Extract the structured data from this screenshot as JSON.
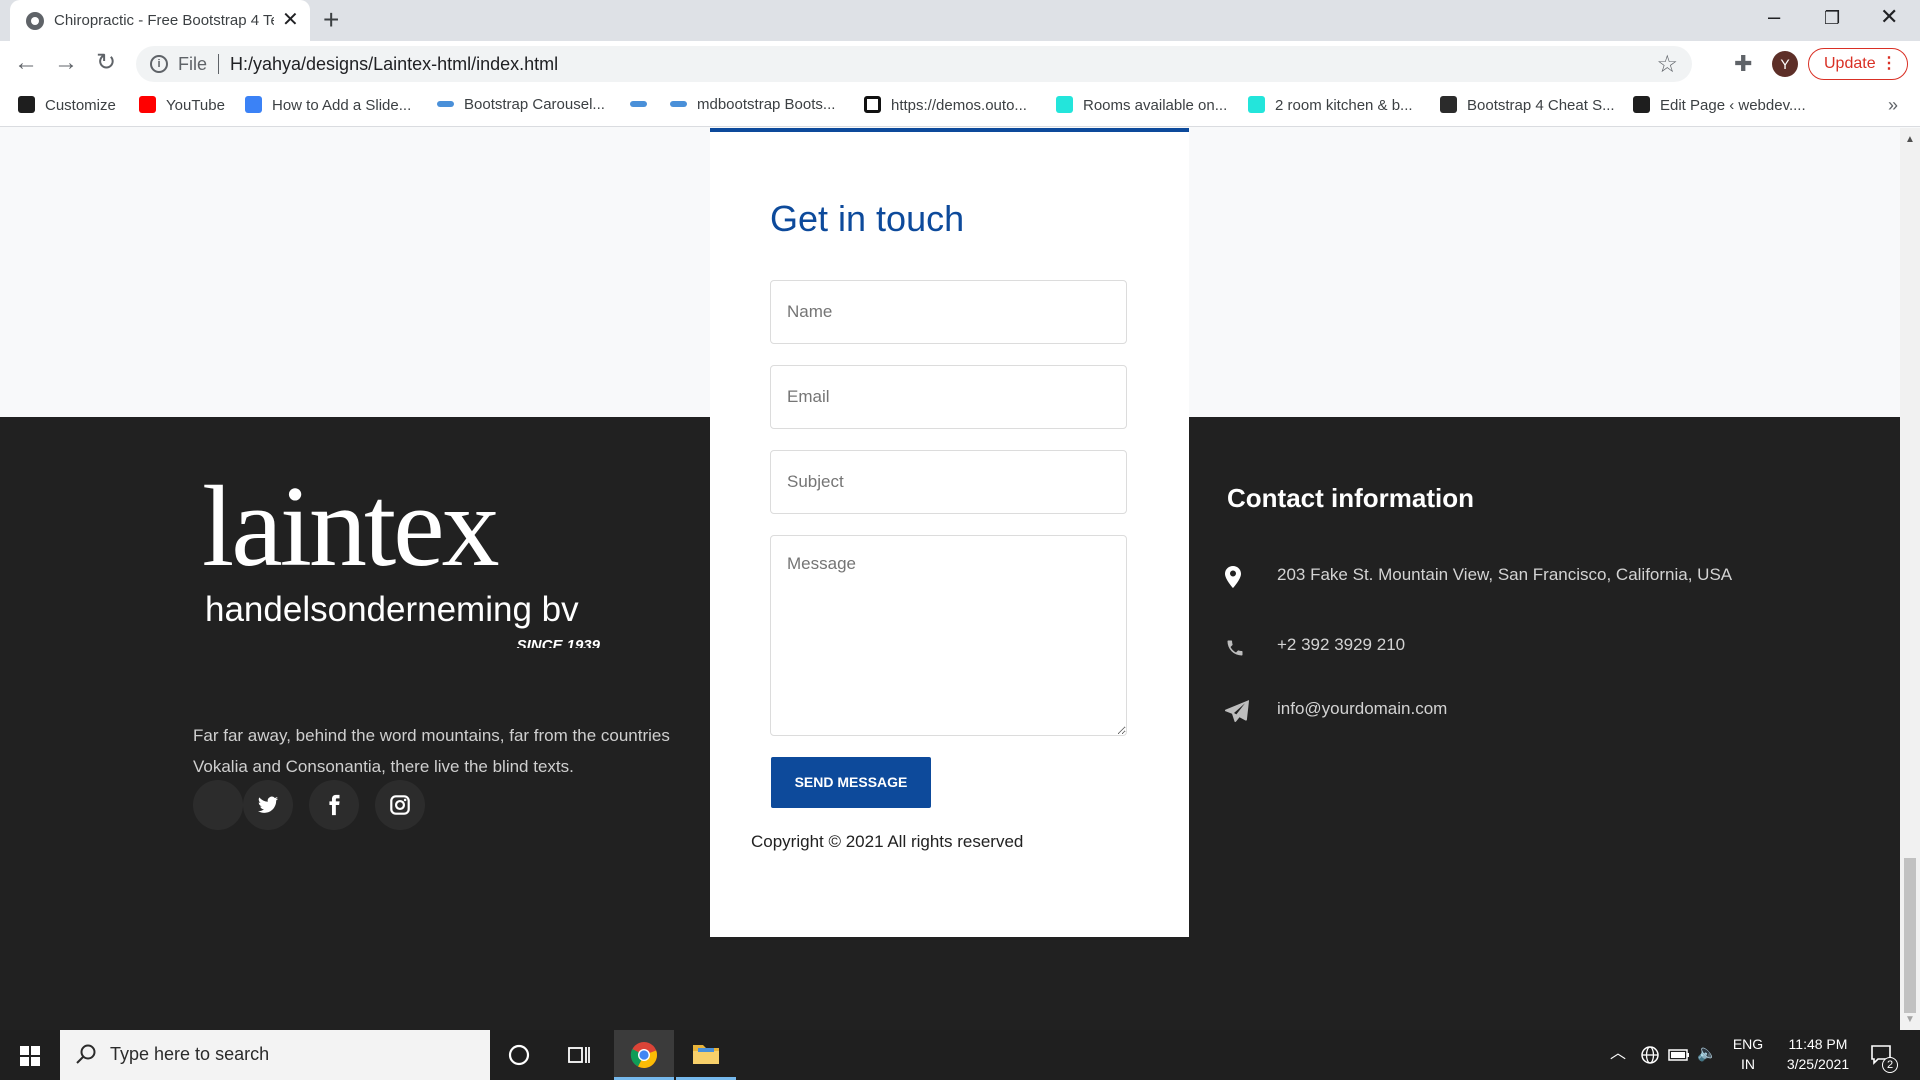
{
  "browser": {
    "tab_title": "Chiropractic - Free Bootstrap 4 Te",
    "address_protocol": "File",
    "address_url": "H:/yahya/designs/Laintex-html/index.html",
    "profile_initial": "Y",
    "update_label": "Update",
    "bookmarks": [
      {
        "label": "Customize",
        "color": "#1e1e1e"
      },
      {
        "label": "YouTube",
        "color": "#ff0000"
      },
      {
        "label": "How to Add a Slide...",
        "color": "#3b82f6"
      },
      {
        "label": "Bootstrap Carousel...",
        "color": "#4a90d9"
      },
      {
        "label": "",
        "color": "#4a90d9"
      },
      {
        "label": "mdbootstrap Boots...",
        "color": "#4a90d9"
      },
      {
        "label": "https://demos.outo...",
        "color": "#111111"
      },
      {
        "label": "Rooms available on...",
        "color": "#23e5db"
      },
      {
        "label": "2 room kitchen & b...",
        "color": "#23e5db"
      },
      {
        "label": "Bootstrap 4 Cheat S...",
        "color": "#2b2b2b"
      },
      {
        "label": "Edit Page ‹ webdev....",
        "color": "#1e1e1e"
      }
    ]
  },
  "page": {
    "logo": {
      "word": "laintex",
      "subtitle": "handelsonderneming bv",
      "since": "SINCE 1939"
    },
    "about_text": "Far far away, behind the word mountains, far from the countries Vokalia and Consonantia, there live the blind texts.",
    "social": [
      "blank-icon",
      "twitter-icon",
      "facebook-icon",
      "instagram-icon"
    ],
    "form": {
      "heading": "Get in touch",
      "name_placeholder": "Name",
      "email_placeholder": "Email",
      "subject_placeholder": "Subject",
      "message_placeholder": "Message",
      "send_label": "SEND MESSAGE"
    },
    "copyright": "Copyright © 2021 All rights reserved",
    "contact": {
      "heading": "Contact information",
      "address": "203 Fake St. Mountain View, San Francisco, California, USA",
      "phone": "+2 392 3929 210",
      "email": "info@yourdomain.com"
    },
    "colors": {
      "accent": "#0d4a9b",
      "footer_bg": "#212121"
    }
  },
  "taskbar": {
    "search_placeholder": "Type here to search",
    "lang_top": "ENG",
    "lang_bottom": "IN",
    "time": "11:48 PM",
    "date": "3/25/2021",
    "notification_count": "2"
  }
}
